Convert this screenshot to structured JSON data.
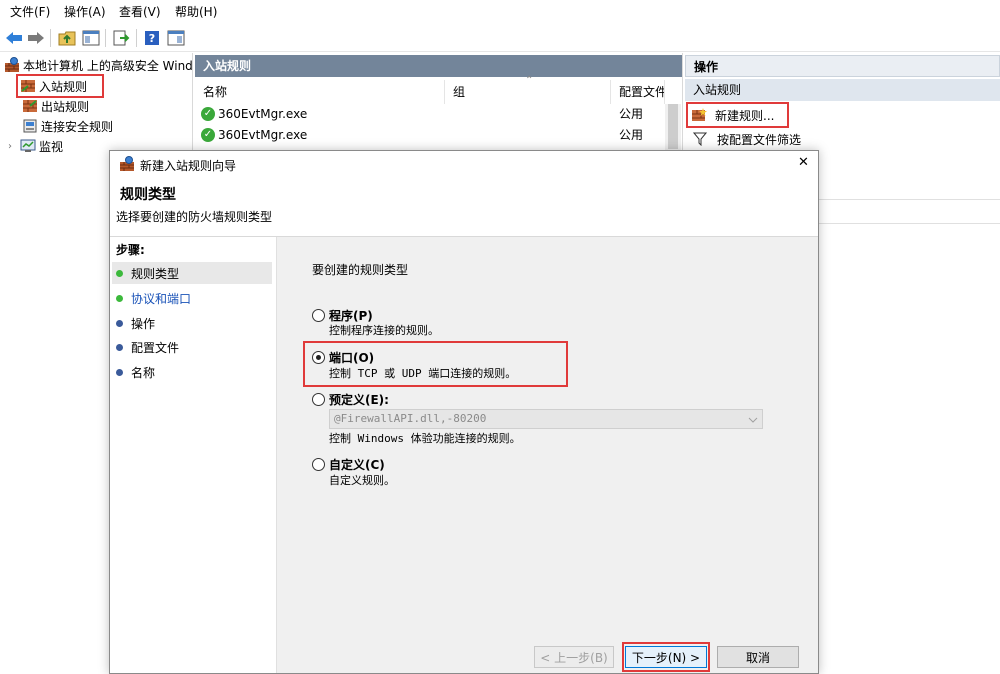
{
  "menu": {
    "file": "文件(F)",
    "action": "操作(A)",
    "view": "查看(V)",
    "help": "帮助(H)"
  },
  "tree": {
    "root": "本地计算机 上的高级安全 Wind",
    "inbound": "入站规则",
    "outbound": "出站规则",
    "connection_security": "连接安全规则",
    "monitor": "监视"
  },
  "middle": {
    "header": "入站规则",
    "columns": {
      "name": "名称",
      "group": "组",
      "profile": "配置文件"
    },
    "rows": [
      {
        "name": "360EvtMgr.exe",
        "profile": "公用"
      },
      {
        "name": "360EvtMgr.exe",
        "profile": "公用"
      }
    ]
  },
  "actions": {
    "header": "操作",
    "section": "入站规则",
    "new_rule": "新建规则...",
    "filter_profile": "按配置文件筛选"
  },
  "dialog": {
    "title": "新建入站规则向导",
    "heading": "规则类型",
    "subheading": "选择要创建的防火墙规则类型",
    "steps_label": "步骤:",
    "steps": [
      "规则类型",
      "协议和端口",
      "操作",
      "配置文件",
      "名称"
    ],
    "prompt": "要创建的规则类型",
    "options": {
      "program": {
        "label": "程序(P)",
        "desc": "控制程序连接的规则。"
      },
      "port": {
        "label": "端口(O)",
        "desc": "控制 TCP 或 UDP 端口连接的规则。"
      },
      "predefined": {
        "label": "预定义(E):",
        "select_value": "@FirewallAPI.dll,-80200",
        "desc": "控制 Windows 体验功能连接的规则。"
      },
      "custom": {
        "label": "自定义(C)",
        "desc": "自定义规则。"
      }
    },
    "buttons": {
      "back": "< 上一步(B)",
      "next": "下一步(N) >",
      "cancel": "取消"
    },
    "close": "✕"
  },
  "colors": {
    "highlight": "#e03a3a",
    "pane_header": "#73859a",
    "dot_green": "#3cb93c",
    "link_blue": "#1a53b8"
  }
}
